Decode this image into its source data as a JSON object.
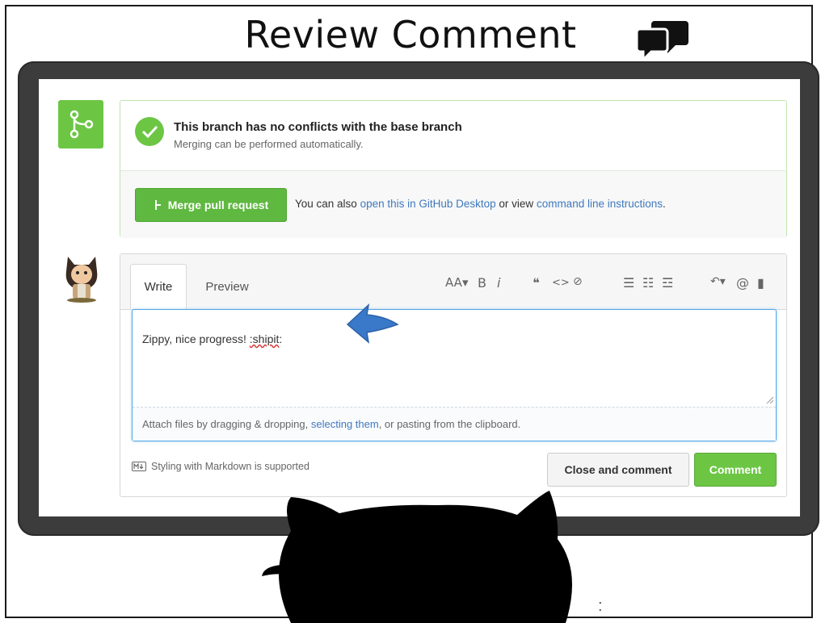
{
  "slide": {
    "title": "Review Comment"
  },
  "merge": {
    "title": "This branch has no conflicts with the base branch",
    "subtitle": "Merging can be performed automatically.",
    "button_label": "Merge pull request",
    "hint_prefix": "You can also ",
    "hint_link1": "open this in GitHub Desktop",
    "hint_mid": " or view ",
    "hint_link2": "command line instructions",
    "hint_suffix": "."
  },
  "comment": {
    "tabs": [
      {
        "label": "Write"
      },
      {
        "label": "Preview"
      }
    ],
    "toolbar": {
      "heading": "AA▾",
      "bold": "B",
      "italic": "i",
      "quote": "❝",
      "code": "<>",
      "link": "⊘",
      "ul": "☰",
      "ol": "☷",
      "task": "☲",
      "reply": "↶▾",
      "mention": "@",
      "bookmark": "▮"
    },
    "text_before": "Zippy, nice progress! ",
    "text_squiggle": ":shipit",
    "text_after": ":",
    "attach_prefix": "Attach files by dragging & dropping, ",
    "attach_link": "selecting them",
    "attach_suffix": ", or pasting from the clipboard.",
    "markdown_hint": "Styling with Markdown is supported",
    "close_button": "Close and comment",
    "comment_button": "Comment"
  },
  "footer": {
    "colon": ":"
  },
  "colors": {
    "green": "#6cc644",
    "link": "#4078c0",
    "arrow": "#3a79c9"
  }
}
